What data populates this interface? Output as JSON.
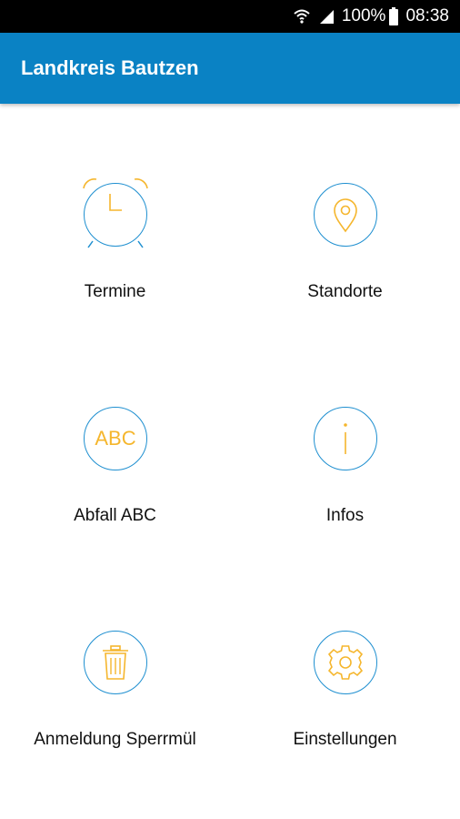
{
  "status_bar": {
    "battery": "100%",
    "time": "08:38",
    "icons": [
      "wifi-icon",
      "signal-icon",
      "battery-icon"
    ]
  },
  "app_bar": {
    "title": "Landkreis Bautzen"
  },
  "menu": [
    {
      "id": "termine",
      "label": "Termine",
      "icon": "alarm-clock-icon"
    },
    {
      "id": "standorte",
      "label": "Standorte",
      "icon": "location-pin-icon"
    },
    {
      "id": "abfall-abc",
      "label": "Abfall ABC",
      "icon": "abc-icon",
      "icon_text": "ABC"
    },
    {
      "id": "infos",
      "label": "Infos",
      "icon": "info-icon"
    },
    {
      "id": "sperrmuell",
      "label": "Anmeldung Sperrmül",
      "icon": "trash-can-icon"
    },
    {
      "id": "einstellungen",
      "label": "Einstellungen",
      "icon": "gear-icon"
    }
  ],
  "colors": {
    "app_bar": "#0a82c4",
    "circle_border": "#1e8fd0",
    "icon_accent": "#f5b62d",
    "status_bar": "#000000"
  }
}
